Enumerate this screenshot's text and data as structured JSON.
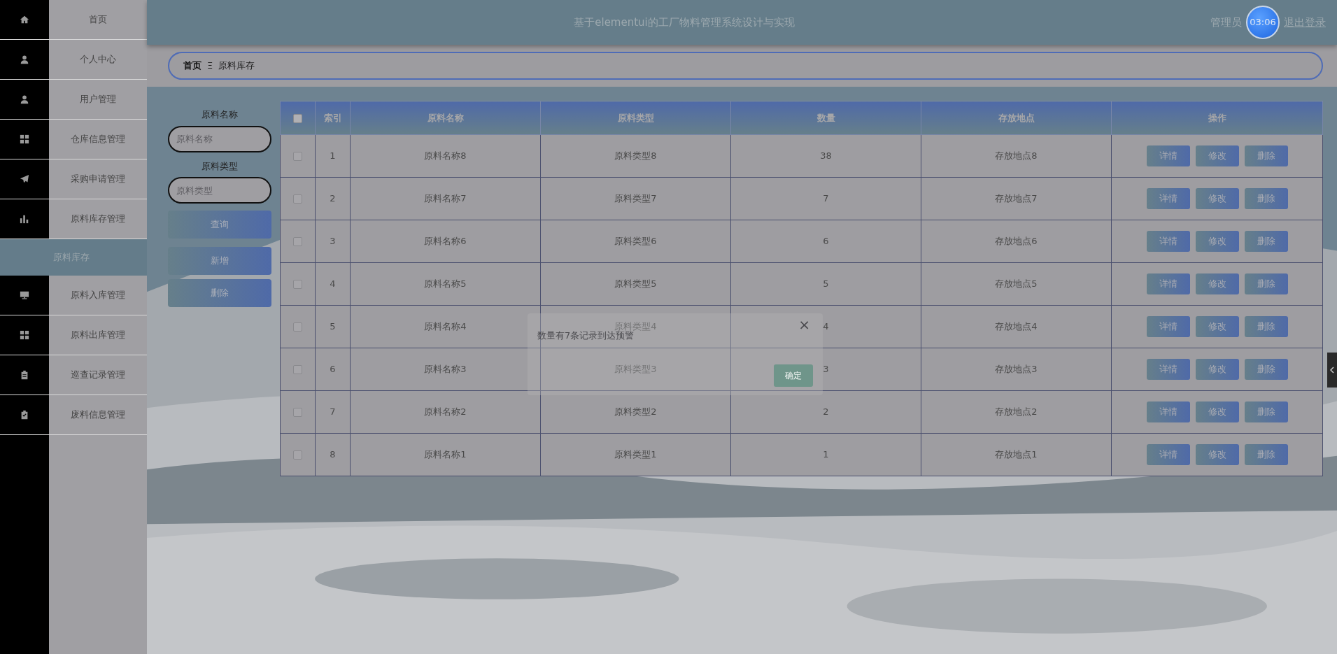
{
  "header": {
    "title": "基于elementui的工厂物料管理系统设计与实现",
    "user": "管理员",
    "timer": "03:06",
    "logout": "退出登录"
  },
  "sidebar": {
    "items": [
      {
        "label": "首页",
        "selected": false
      },
      {
        "label": "个人中心",
        "selected": false
      },
      {
        "label": "用户管理",
        "selected": false
      },
      {
        "label": "仓库信息管理",
        "selected": false
      },
      {
        "label": "采购申请管理",
        "selected": false
      },
      {
        "label": "原料库存管理",
        "selected": false
      },
      {
        "label": "原料库存",
        "selected": true
      },
      {
        "label": "原料入库管理",
        "selected": false
      },
      {
        "label": "原料出库管理",
        "selected": false
      },
      {
        "label": "巡查记录管理",
        "selected": false
      },
      {
        "label": "废料信息管理",
        "selected": false
      }
    ]
  },
  "breadcrumb": [
    "首页",
    "原料库存"
  ],
  "breadcrumb_separator": "Ξ",
  "filters": [
    {
      "label": "原料名称",
      "placeholder": "原料名称"
    },
    {
      "label": "原料类型",
      "placeholder": "原料类型"
    }
  ],
  "filter_buttons": [
    "查询",
    "新增",
    "删除"
  ],
  "table": {
    "header_checked": false,
    "columns": [
      "索引",
      "原料名称",
      "原料类型",
      "数量",
      "存放地点",
      "操作"
    ],
    "rows": [
      {
        "checked": false,
        "cells": [
          "1",
          "原料名称8",
          "原料类型8",
          "38",
          "存放地点8"
        ],
        "actions": [
          "详情",
          "修改",
          "删除"
        ]
      },
      {
        "checked": false,
        "cells": [
          "2",
          "原料名称7",
          "原料类型7",
          "7",
          "存放地点7"
        ],
        "actions": [
          "详情",
          "修改",
          "删除"
        ]
      },
      {
        "checked": false,
        "cells": [
          "3",
          "原料名称6",
          "原料类型6",
          "6",
          "存放地点6"
        ],
        "actions": [
          "详情",
          "修改",
          "删除"
        ]
      },
      {
        "checked": false,
        "cells": [
          "4",
          "原料名称5",
          "原料类型5",
          "5",
          "存放地点5"
        ],
        "actions": [
          "详情",
          "修改",
          "删除"
        ]
      },
      {
        "checked": false,
        "cells": [
          "5",
          "原料名称4",
          "原料类型4",
          "4",
          "存放地点4"
        ],
        "actions": [
          "详情",
          "修改",
          "删除"
        ]
      },
      {
        "checked": false,
        "cells": [
          "6",
          "原料名称3",
          "原料类型3",
          "3",
          "存放地点3"
        ],
        "actions": [
          "详情",
          "修改",
          "删除"
        ]
      },
      {
        "checked": false,
        "cells": [
          "7",
          "原料名称2",
          "原料类型2",
          "2",
          "存放地点2"
        ],
        "actions": [
          "详情",
          "修改",
          "删除"
        ]
      },
      {
        "checked": false,
        "cells": [
          "8",
          "原料名称1",
          "原料类型1",
          "1",
          "存放地点1"
        ],
        "actions": [
          "详情",
          "修改",
          "删除"
        ]
      }
    ]
  },
  "dialog": {
    "message": "数量有7条记录到达预警",
    "close": "×",
    "button": "确定"
  }
}
